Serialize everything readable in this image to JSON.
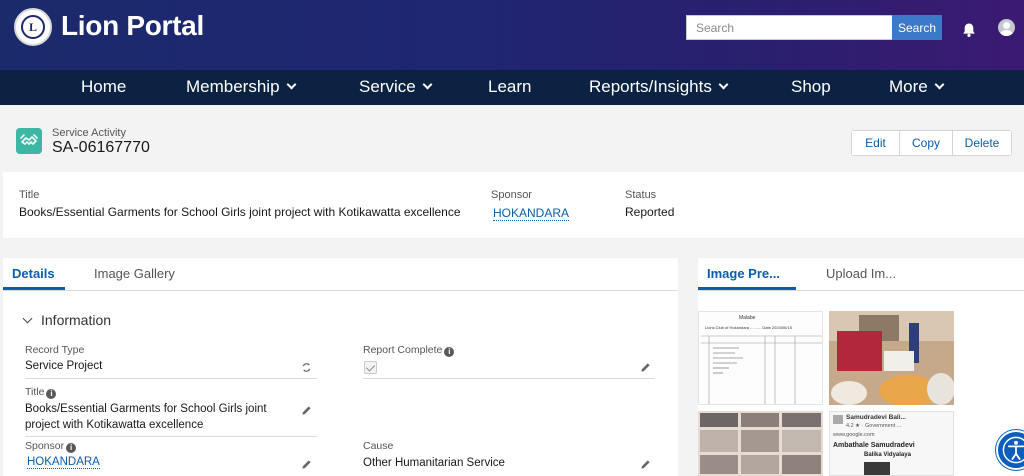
{
  "header": {
    "brand": "Lion Portal",
    "search_placeholder": "Search",
    "search_button": "Search",
    "colors": {
      "gradient_start": "#1b2a6b",
      "gradient_end": "#3b1a73",
      "nav": "#0c2242",
      "accent": "#3c79c9"
    },
    "icons": [
      "lions-logo-icon",
      "bell-icon",
      "user-avatar-icon"
    ]
  },
  "nav": {
    "items": [
      {
        "label": "Home",
        "dropdown": false
      },
      {
        "label": "Membership",
        "dropdown": true
      },
      {
        "label": "Service",
        "dropdown": true
      },
      {
        "label": "Learn",
        "dropdown": false
      },
      {
        "label": "Reports/Insights",
        "dropdown": true
      },
      {
        "label": "Shop",
        "dropdown": false
      },
      {
        "label": "More",
        "dropdown": true
      }
    ]
  },
  "record": {
    "object_type": "Service Activity",
    "record_id": "SA-06167770",
    "actions": [
      "Edit",
      "Copy",
      "Delete"
    ],
    "icon": "service-activity-icon"
  },
  "highlights": {
    "title_label": "Title",
    "title_value": "Books/Essential Garments for School Girls joint project with Kotikawatta excellence",
    "sponsor_label": "Sponsor",
    "sponsor_value": "HOKANDARA",
    "status_label": "Status",
    "status_value": "Reported"
  },
  "details": {
    "tabs": [
      "Details",
      "Image Gallery"
    ],
    "active_tab": "Details",
    "section": "Information",
    "fields": {
      "record_type_label": "Record Type",
      "record_type_value": "Service Project",
      "report_complete_label": "Report Complete",
      "report_complete_checked": true,
      "title_label": "Title",
      "title_value_line1": "Books/Essential Garments for School Girls joint",
      "title_value_line2": "project with Kotikawatta excellence",
      "sponsor_label": "Sponsor",
      "sponsor_value": "HOKANDARA",
      "cause_label": "Cause",
      "cause_value": "Other Humanitarian Service"
    }
  },
  "gallery": {
    "tabs": [
      "Image Pre...",
      "Upload Im..."
    ],
    "active_tab": "Image Pre...",
    "doc_heading": "Malabe",
    "doc_subheading": "Lions Club of Hokandara .......... Date 2024/06/15",
    "card_title": "Samudradevi Bali...",
    "card_rating": "4.2 ★ · Government ...",
    "card_url": "www.google.com",
    "card_caption_1": "Ambathale Samudradevi",
    "card_caption_2": "Balika Vidyalaya"
  }
}
